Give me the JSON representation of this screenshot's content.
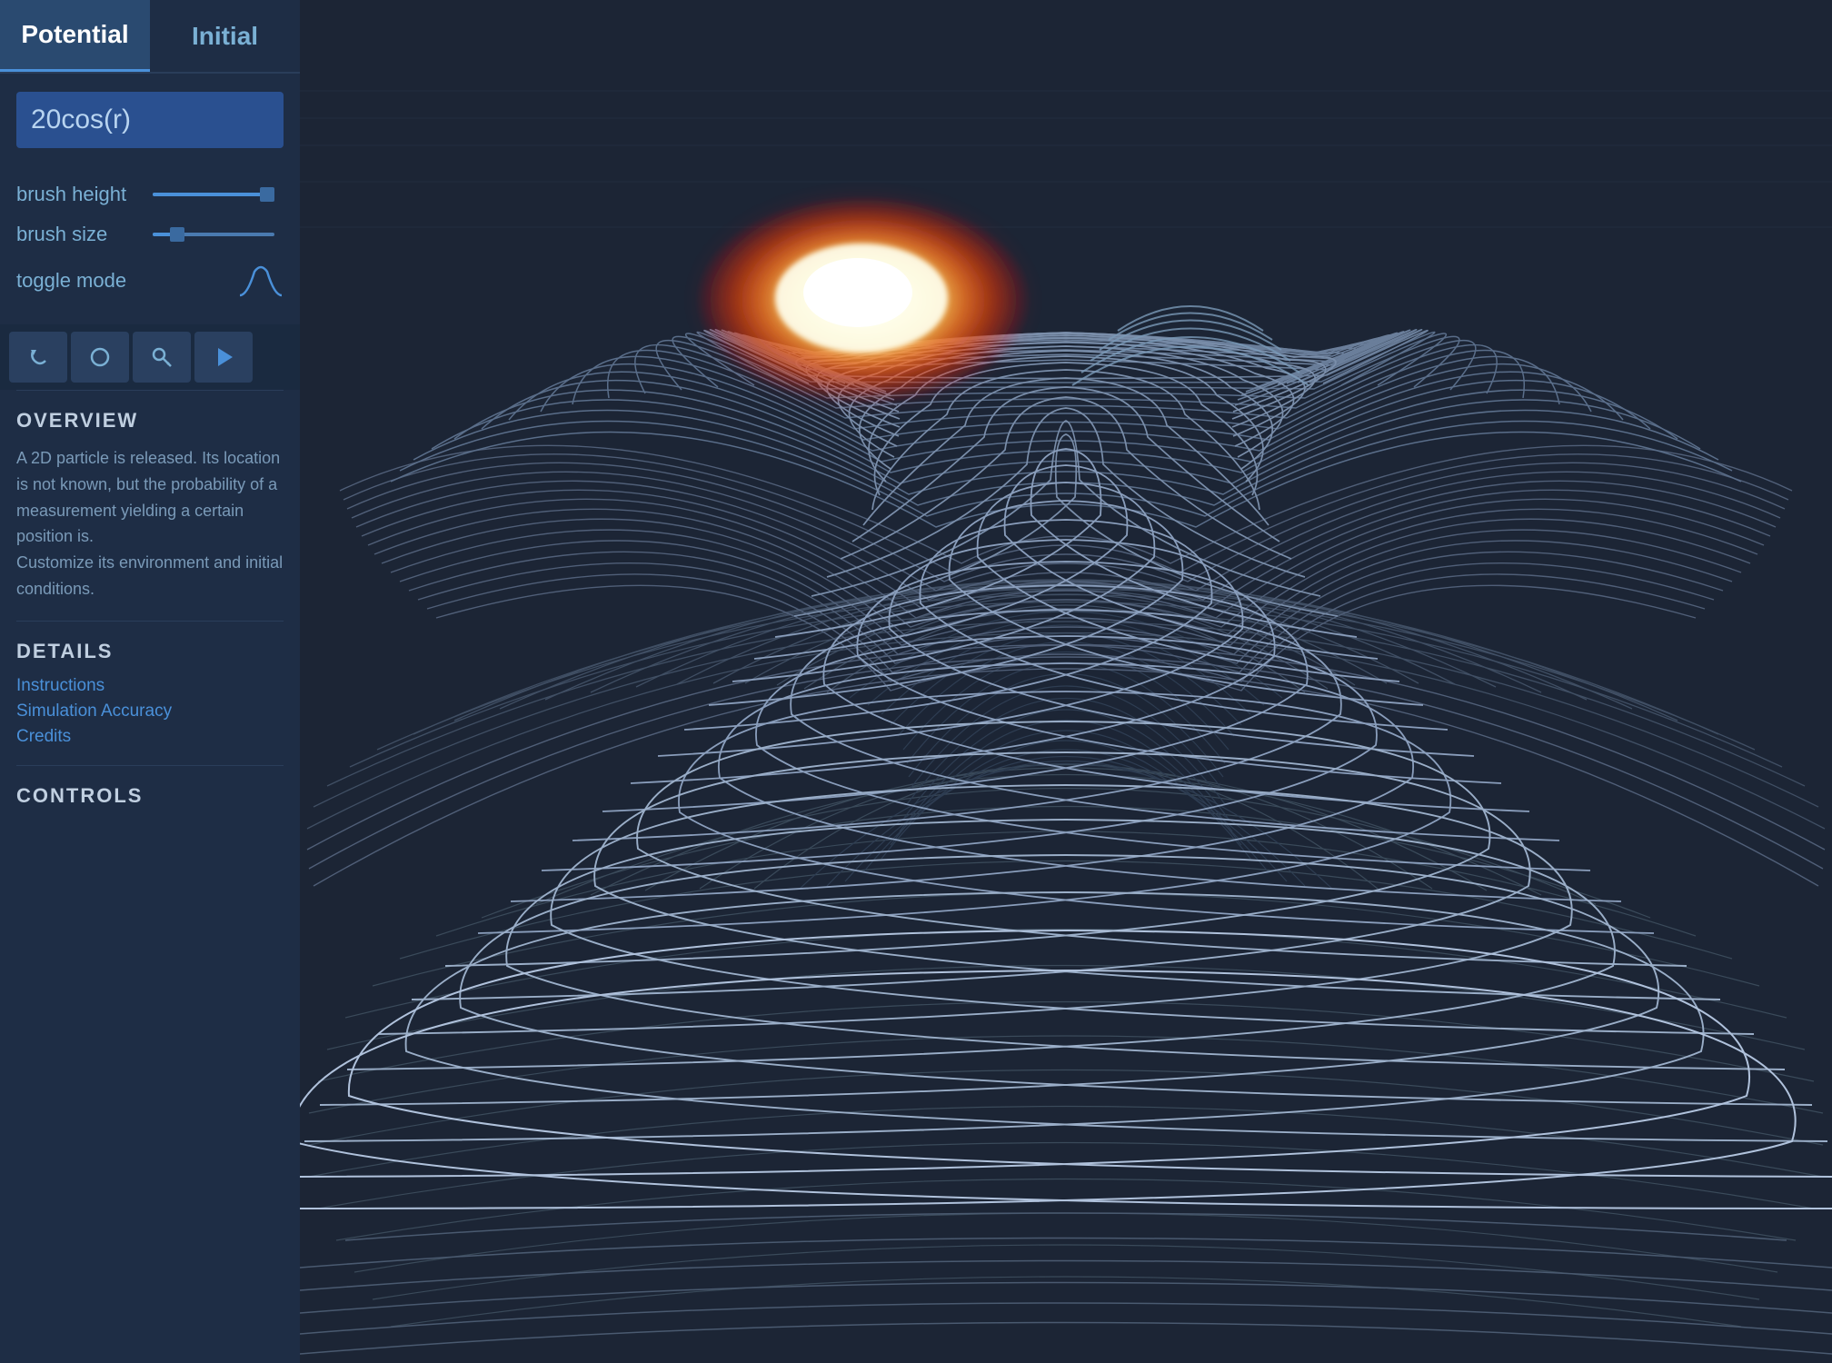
{
  "tabs": [
    {
      "id": "potential",
      "label": "Potential",
      "active": true
    },
    {
      "id": "initial",
      "label": "Initial",
      "active": false
    }
  ],
  "formula": {
    "value": "20cos(r)",
    "placeholder": "20cos(r)"
  },
  "controls": {
    "brush_height": {
      "label": "brush height",
      "value": 90,
      "min": 0,
      "max": 100
    },
    "brush_size": {
      "label": "brush size",
      "value": 20,
      "min": 0,
      "max": 100
    },
    "toggle_mode": {
      "label": "toggle mode"
    }
  },
  "action_bar": {
    "buttons": [
      {
        "id": "undo",
        "icon": "↺",
        "label": "undo"
      },
      {
        "id": "reset",
        "icon": "○",
        "label": "reset"
      },
      {
        "id": "key",
        "icon": "🔑",
        "label": "key"
      },
      {
        "id": "play",
        "icon": "▶",
        "label": "play"
      }
    ]
  },
  "overview": {
    "title": "OVERVIEW",
    "text": "A 2D particle is released.  Its location is not known, but the probability of a measurement yielding a certain position is.\nCustomize its environment and initial conditions."
  },
  "details": {
    "title": "DETAILS",
    "links": [
      "Instructions",
      "Simulation Accuracy",
      "Credits"
    ]
  },
  "controls_section": {
    "title": "CONTROLS"
  },
  "colors": {
    "accent": "#4a90d9",
    "sidebar_bg": "#1e2d45",
    "tab_active_bg": "#2a4a70",
    "formula_bg": "#2a5090",
    "action_bar_bg": "#1a2a40",
    "text_primary": "#ffffff",
    "text_secondary": "#7ab0d4",
    "link_color": "#4a90d9"
  }
}
